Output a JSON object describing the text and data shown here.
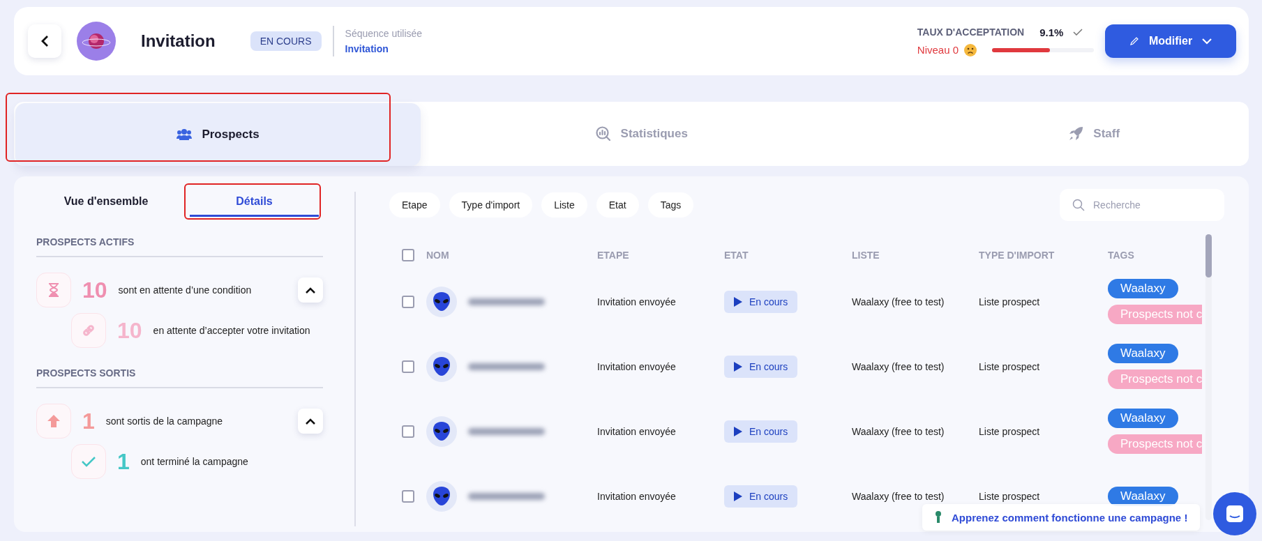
{
  "header": {
    "title": "Invitation",
    "status_badge": "EN COURS",
    "sequence_label": "Séquence utilisée",
    "sequence_link": "Invitation",
    "acceptance_label": "TAUX D'ACCEPTATION",
    "acceptance_value": "9.1%",
    "level_text": "Niveau 0",
    "acceptance": {
      "level": 0.57
    },
    "edit_button": "Modifier"
  },
  "tabs": [
    {
      "label": "Prospects",
      "selected": true,
      "highlighted": true
    },
    {
      "label": "Statistiques",
      "selected": false,
      "highlighted": false
    },
    {
      "label": "Staff",
      "selected": false,
      "highlighted": false
    }
  ],
  "subtabs": [
    {
      "label": "Vue d'ensemble",
      "selected": false,
      "highlighted": false
    },
    {
      "label": "Détails",
      "selected": true,
      "highlighted": true
    }
  ],
  "sections": [
    {
      "title": "PROSPECTS ACTIFS",
      "expanded": true,
      "main": {
        "count": "10",
        "text": "sont en attente d’une condition",
        "color": "#ef8fb0"
      },
      "children": [
        {
          "count": "10",
          "text": "en attente d’accepter votre invitation",
          "color": "#f5b5cc"
        }
      ]
    },
    {
      "title": "PROSPECTS SORTIS",
      "expanded": true,
      "main": {
        "count": "1",
        "text": "sont sortis de la campagne",
        "color": "#f49a9a"
      },
      "children": [
        {
          "count": "1",
          "text": "ont terminé la campagne",
          "color": "#45c7c6"
        }
      ]
    }
  ],
  "filters": [
    "Etape",
    "Type d'import",
    "Liste",
    "Etat",
    "Tags"
  ],
  "search": {
    "placeholder": "Recherche"
  },
  "table": {
    "columns": [
      "NOM",
      "ETAPE",
      "ETAT",
      "LISTE",
      "TYPE D'IMPORT",
      "TAGS"
    ],
    "select_all": {
      "checked": false
    },
    "rows": [
      {
        "checked": false,
        "etape": "Invitation envoyée",
        "etat": "En cours",
        "liste": "Waalaxy (free to test)",
        "type": "Liste prospect",
        "tags": [
          {
            "label": "Waalaxy",
            "color": "#2f7ae5"
          },
          {
            "label": "Prospects not c",
            "color": "#f7a8c4"
          }
        ]
      },
      {
        "checked": false,
        "etape": "Invitation envoyée",
        "etat": "En cours",
        "liste": "Waalaxy (free to test)",
        "type": "Liste prospect",
        "tags": [
          {
            "label": "Waalaxy",
            "color": "#2f7ae5"
          },
          {
            "label": "Prospects not c",
            "color": "#f7a8c4"
          }
        ]
      },
      {
        "checked": false,
        "etape": "Invitation envoyée",
        "etat": "En cours",
        "liste": "Waalaxy (free to test)",
        "type": "Liste prospect",
        "tags": [
          {
            "label": "Waalaxy",
            "color": "#2f7ae5"
          },
          {
            "label": "Prospects not c",
            "color": "#f7a8c4"
          }
        ]
      },
      {
        "checked": false,
        "etape": "Invitation envoyée",
        "etat": "En cours",
        "liste": "Waalaxy (free to test)",
        "type": "Liste prospect",
        "tags": [
          {
            "label": "Waalaxy",
            "color": "#2f7ae5"
          }
        ]
      }
    ]
  },
  "toast": {
    "text": "Apprenez comment fonctionne une campagne !"
  }
}
